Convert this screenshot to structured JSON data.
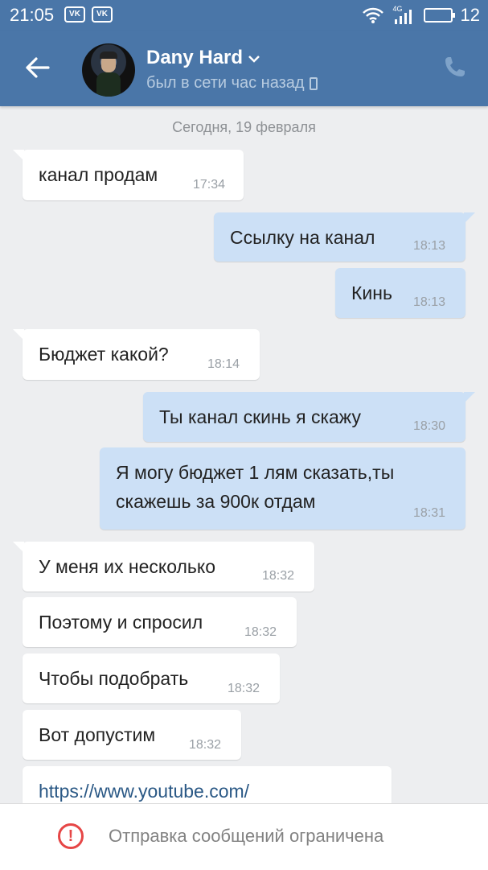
{
  "statusbar": {
    "time": "21:05",
    "battery": "12",
    "vk1": "VK",
    "vk2": "VK",
    "network": "4G"
  },
  "header": {
    "name": "Dany Hard",
    "status": "был в сети час назад",
    "accent": "#4a76a8"
  },
  "date_separator": "Сегодня, 19 февраля",
  "messages": [
    {
      "dir": "in",
      "text": "канал продам",
      "time": "17:34"
    },
    {
      "dir": "out",
      "text": "Ссылку на канал",
      "time": "18:13"
    },
    {
      "dir": "out",
      "text": "Кинь",
      "time": "18:13"
    },
    {
      "dir": "in",
      "text": "Бюджет какой?",
      "time": "18:14"
    },
    {
      "dir": "out",
      "text": "Ты канал скинь я скажу",
      "time": "18:30"
    },
    {
      "dir": "out",
      "text_line1": "Я могу бюджет 1 лям сказать,ты",
      "text_line2": "скажешь за 900к отдам",
      "time": "18:31"
    },
    {
      "dir": "in",
      "text": "У меня их несколько",
      "time": "18:32"
    },
    {
      "dir": "in",
      "text": "Поэтому и спросил",
      "time": "18:32"
    },
    {
      "dir": "in",
      "text": "Чтобы подобрать",
      "time": "18:32"
    },
    {
      "dir": "in",
      "text": "Вот допустим",
      "time": "18:32"
    },
    {
      "dir": "in",
      "text": "https://www.youtube.com/",
      "link": true
    }
  ],
  "bottom": {
    "restriction": "Отправка сообщений ограничена"
  }
}
